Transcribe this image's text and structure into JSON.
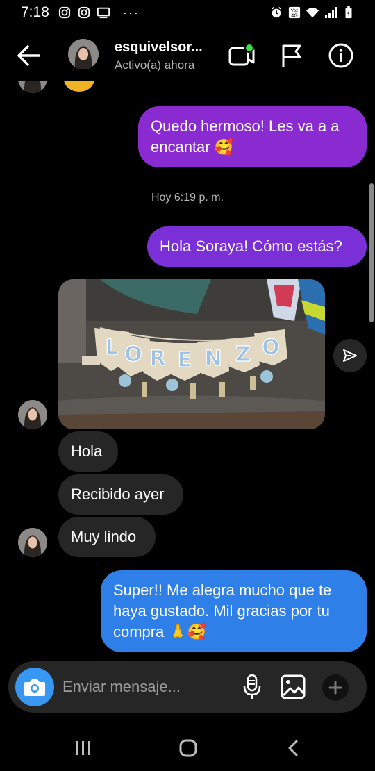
{
  "status_bar": {
    "time": "7:18",
    "left_icons": [
      "instagram-icon",
      "instagram-icon",
      "screen-cast-icon"
    ],
    "overflow": "···",
    "right_icons": [
      "alarm-icon",
      "volte-icon",
      "wifi-icon",
      "signal-icon",
      "battery-icon"
    ]
  },
  "header": {
    "username": "esquivelsor...",
    "status": "Activo(a) ahora",
    "online_dot_color": "#3cdc46",
    "icons": [
      "back-arrow-icon",
      "video-call-icon",
      "flag-icon",
      "info-icon"
    ]
  },
  "chat": {
    "messages": [
      {
        "id": "m1",
        "direction": "outgoing",
        "lines": [
          "Quedo hermoso! Les va a a",
          "encantar 🥰"
        ],
        "color": "#8a2bd1"
      },
      {
        "id": "m2",
        "direction": "outgoing",
        "lines": [
          "Hola Soraya! Cómo estás?"
        ],
        "color": "#7b2fd6"
      },
      {
        "id": "m3",
        "direction": "incoming",
        "type": "photo",
        "description_icon": "photo-garland-image"
      },
      {
        "id": "m4",
        "direction": "incoming",
        "lines": [
          "Hola"
        ]
      },
      {
        "id": "m5",
        "direction": "incoming",
        "lines": [
          "Recibido ayer"
        ]
      },
      {
        "id": "m6",
        "direction": "incoming",
        "lines": [
          "Muy lindo"
        ]
      },
      {
        "id": "m7",
        "direction": "outgoing",
        "lines": [
          "Super!! Me alegra mucho que te",
          "haya gustado. Mil gracias por tu",
          "compra 🙏🥰"
        ],
        "color": "#2f7fe8"
      }
    ],
    "timestamp": "Hoy 6:19 p. m.",
    "garland_letters": [
      "L",
      "O",
      "R",
      "E",
      "N",
      "Z",
      "O"
    ]
  },
  "composer": {
    "placeholder": "Enviar mensaje...",
    "icons": [
      "camera-icon",
      "microphone-icon",
      "gallery-icon",
      "plus-icon"
    ],
    "camera_color": "#3897f0"
  },
  "navbar": {
    "icons": [
      "recent-apps-icon",
      "home-icon",
      "back-icon"
    ]
  }
}
